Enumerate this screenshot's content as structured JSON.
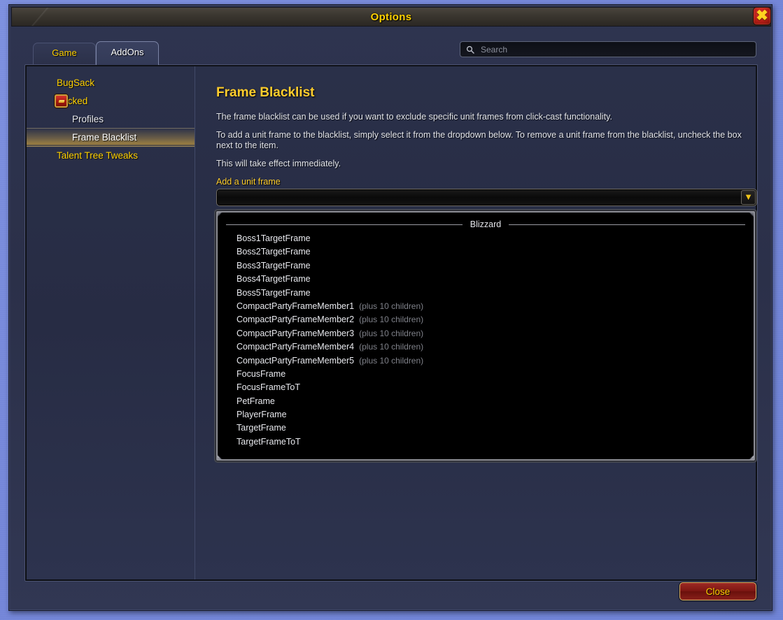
{
  "window": {
    "title": "Options",
    "close_icon": "close-x-icon"
  },
  "tabs": [
    {
      "label": "Game",
      "active": false
    },
    {
      "label": "AddOns",
      "active": true
    }
  ],
  "search": {
    "placeholder": "Search",
    "value": "",
    "icon": "search-icon"
  },
  "sidebar": {
    "items": [
      {
        "label": "BugSack",
        "depth": 0,
        "selected": false,
        "icon": null
      },
      {
        "label": "Clicked",
        "depth": 0,
        "selected": false,
        "icon": "addon-icon"
      },
      {
        "label": "Profiles",
        "depth": 1,
        "selected": false,
        "icon": null
      },
      {
        "label": "Frame Blacklist",
        "depth": 1,
        "selected": true,
        "icon": null
      },
      {
        "label": "Talent Tree Tweaks",
        "depth": 0,
        "selected": false,
        "icon": null
      }
    ]
  },
  "content": {
    "title": "Frame Blacklist",
    "paragraphs": [
      "The frame blacklist can be used if you want to exclude specific unit frames from click-cast functionality.",
      "To add a unit frame to the blacklist, simply select it from the dropdown below. To remove a unit frame from the blacklist, uncheck the box next to the item.",
      "This will take effect immediately."
    ],
    "dropdown": {
      "label": "Add a unit frame",
      "value": "",
      "arrow_icon": "chevron-down-icon"
    },
    "frame_list": {
      "section_header": "Blizzard",
      "rows": [
        {
          "name": "Boss1TargetFrame",
          "note": ""
        },
        {
          "name": "Boss2TargetFrame",
          "note": ""
        },
        {
          "name": "Boss3TargetFrame",
          "note": ""
        },
        {
          "name": "Boss4TargetFrame",
          "note": ""
        },
        {
          "name": "Boss5TargetFrame",
          "note": ""
        },
        {
          "name": "CompactPartyFrameMember1",
          "note": "(plus 10 children)"
        },
        {
          "name": "CompactPartyFrameMember2",
          "note": "(plus 10 children)"
        },
        {
          "name": "CompactPartyFrameMember3",
          "note": "(plus 10 children)"
        },
        {
          "name": "CompactPartyFrameMember4",
          "note": "(plus 10 children)"
        },
        {
          "name": "CompactPartyFrameMember5",
          "note": "(plus 10 children)"
        },
        {
          "name": "FocusFrame",
          "note": ""
        },
        {
          "name": "FocusFrameToT",
          "note": ""
        },
        {
          "name": "PetFrame",
          "note": ""
        },
        {
          "name": "PlayerFrame",
          "note": ""
        },
        {
          "name": "TargetFrame",
          "note": ""
        },
        {
          "name": "TargetFrameToT",
          "note": ""
        }
      ]
    }
  },
  "footer": {
    "close_label": "Close"
  },
  "colors": {
    "gold_text": "#ffd100",
    "title_gold": "#ffcd2c",
    "white_text": "#e8e9ee",
    "muted_text": "#7f8189",
    "close_button_red": "#7d1712",
    "panel_bg": "#272c44",
    "list_bg": "#000000"
  }
}
